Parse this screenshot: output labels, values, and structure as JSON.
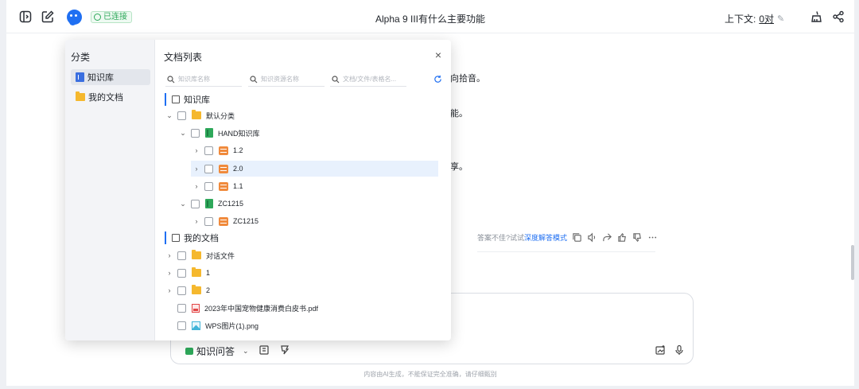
{
  "header": {
    "status_badge": "已连接",
    "title": "Alpha 9 III有什么主要功能",
    "context_label": "上下文:",
    "context_value": "0对"
  },
  "background": {
    "line1": "向拾音。",
    "line2": "能。",
    "line3": "享。",
    "feedback_prompt": "答案不佳?试试",
    "feedback_link": "深度解答模式"
  },
  "composer": {
    "mode_label": "知识问答"
  },
  "footer": {
    "disclaimer": "内容由AI生成，不能保证完全准确，请仔细甄别"
  },
  "modal": {
    "category_title": "分类",
    "categories": [
      {
        "label": "知识库"
      },
      {
        "label": "我的文档"
      }
    ],
    "doc_title": "文档列表",
    "search_placeholders": {
      "kb_name": "知识库名称",
      "resource_name": "知识资源名称",
      "doc": "文档/文件/表格名..."
    },
    "section_kb": "知识库",
    "section_mydocs": "我的文档",
    "tree": [
      {
        "label": "默认分类"
      },
      {
        "label": "HAND知识库"
      },
      {
        "label": "1.2"
      },
      {
        "label": "2.0"
      },
      {
        "label": "1.1"
      },
      {
        "label": "ZC1215"
      },
      {
        "label": "ZC1215"
      }
    ],
    "mydocs": [
      {
        "label": "对话文件"
      },
      {
        "label": "1"
      },
      {
        "label": "2"
      },
      {
        "label": "2023年中国宠物健康消费白皮书.pdf"
      },
      {
        "label": "WPS图片(1).png"
      }
    ]
  }
}
